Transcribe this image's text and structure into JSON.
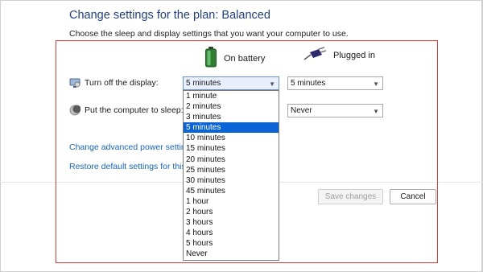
{
  "page": {
    "title": "Change settings for the plan: Balanced",
    "subtitle": "Choose the sleep and display settings that you want your computer to use."
  },
  "columns": {
    "on_battery": "On battery",
    "plugged_in": "Plugged in"
  },
  "rows": {
    "display": {
      "label": "Turn off the display:",
      "battery_value": "5 minutes",
      "plugged_value": "5 minutes"
    },
    "sleep": {
      "label": "Put the computer to sleep:",
      "plugged_value": "Never"
    }
  },
  "links": {
    "advanced": "Change advanced power settings",
    "restore": "Restore default settings for this pl"
  },
  "buttons": {
    "save": "Save changes",
    "cancel": "Cancel"
  },
  "dropdown": {
    "selected": "5 minutes",
    "options": [
      "1 minute",
      "2 minutes",
      "3 minutes",
      "5 minutes",
      "10 minutes",
      "15 minutes",
      "20 minutes",
      "25 minutes",
      "30 minutes",
      "45 minutes",
      "1 hour",
      "2 hours",
      "3 hours",
      "4 hours",
      "5 hours",
      "Never"
    ]
  },
  "icons": {
    "battery": "battery-icon",
    "plug": "plug-icon",
    "display": "monitor-icon",
    "sleep": "moon-icon"
  },
  "colors": {
    "title": "#1e3f8a",
    "link": "#1565c0",
    "highlight": "#e53935",
    "selection": "#0a64d6"
  }
}
